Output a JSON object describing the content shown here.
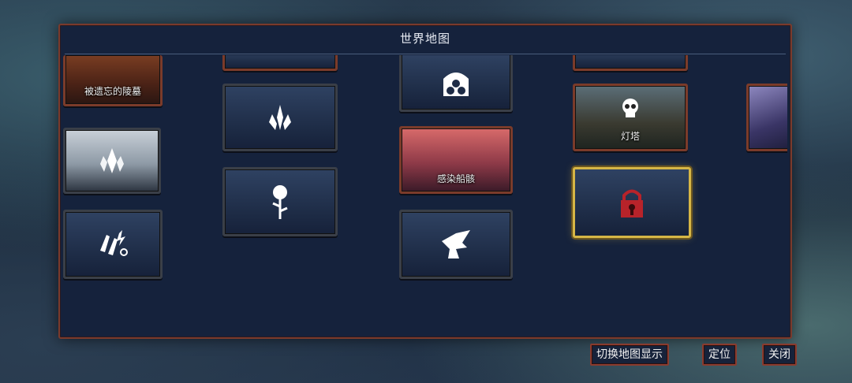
{
  "panel": {
    "title": "世界地图"
  },
  "cards": {
    "forgotten_tomb": "被遗忘的陵墓",
    "infected_wreck": "感染船骸",
    "lighthouse": "灯塔"
  },
  "buttons": {
    "switch_map": "切换地图显示",
    "locate": "定位",
    "close": "关闭"
  },
  "colors": {
    "panel_bg": "#15223c",
    "panel_border": "#7a3a2c",
    "selected_border": "#d6b646",
    "lock_red": "#b8232a"
  },
  "icons": [
    "crystal-icon",
    "flame-icon",
    "rose-icon",
    "skull-icon",
    "lock-icon",
    "gargoyle-icon",
    "bank-icon",
    "broken-wall-icon"
  ]
}
